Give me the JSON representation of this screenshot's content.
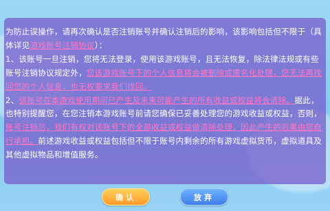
{
  "dialog": {
    "intro_1": "为防止误操作，请再次确认是否注销账号并确认注销后的影响，该影响包括但不限于（具体详见",
    "agreement_link": "游戏账号注销协议",
    "intro_2": "）：",
    "item1_a": "1、该账号一旦注销，您将无法登录，使用该游戏账号，且无法恢复，除法律法规或有些账号注销协议规定外，",
    "item1_b": "您该游戏账号下的个人信息将会被删除或匿名化处理，您无法再找回您的个人信息，也无权要求我们找回。",
    "item2_a": "2、",
    "item2_b": "该账号在本游戏使用期间已产生及未来可能产生的所有收益或权益将会清除。",
    "item2_c": "据此，也特别提醒您，在您注销本游戏账号前请您确保已妥善处理您的游戏收益或权益，否则，",
    "item2_d": "账号注销后，我们有权对该账号下的全部收益或权益做清除处理，因此产生的后果由您自行承担。",
    "item2_e": "前述游戏收益或权益包括但不限于账号内剩余的所有游戏虚拟货币，虚拟道具及其他虚拟物品和增值服务。"
  },
  "buttons": {
    "confirm": "确认",
    "cancel": "放弃"
  },
  "colors": {
    "highlight": "#ff78c8",
    "confirm_button": "#ffb13c",
    "cancel_button": "#4f8ff0"
  }
}
